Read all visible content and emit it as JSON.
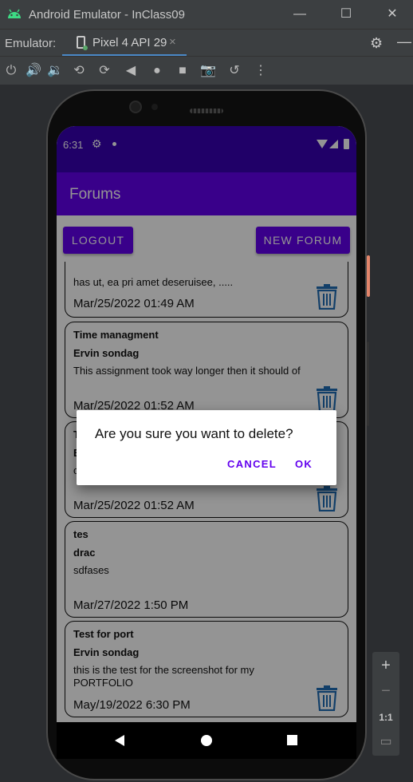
{
  "window": {
    "title": "Android Emulator - InClass09",
    "controls": [
      "—",
      "☐",
      "✕"
    ]
  },
  "tabbar": {
    "label": "Emulator:",
    "tab_label": "Pixel 4 API 29",
    "tab_close": "×",
    "settings_glyph": "⚙",
    "minimize_glyph": "—"
  },
  "toolbar": {
    "tools": [
      {
        "name": "power-icon",
        "glyph": "⏻"
      },
      {
        "name": "volume-up-icon",
        "glyph": "🔊"
      },
      {
        "name": "volume-down-icon",
        "glyph": "🔉"
      },
      {
        "name": "rotate-left-icon",
        "glyph": "⟲"
      },
      {
        "name": "rotate-right-icon",
        "glyph": "⟳"
      },
      {
        "name": "back-icon",
        "glyph": "◀"
      },
      {
        "name": "home-icon",
        "glyph": "●"
      },
      {
        "name": "overview-icon",
        "glyph": "■"
      },
      {
        "name": "camera-icon",
        "glyph": "📷"
      },
      {
        "name": "snapshot-icon",
        "glyph": "↺"
      },
      {
        "name": "more-icon",
        "glyph": "⋮"
      }
    ]
  },
  "zoom": {
    "plus": "+",
    "minus": "−",
    "ratio": "1:1",
    "fit": "▭"
  },
  "device": {
    "status": {
      "time": "6:31",
      "gear": "⚙"
    },
    "app_title": "Forums",
    "buttons": {
      "logout": "LOGOUT",
      "new_forum": "NEW FORUM"
    },
    "forums": [
      {
        "title": "",
        "author": "",
        "body": "has ut, ea pri amet deseruisee, .....",
        "date": "Mar/25/2022 01:49 AM"
      },
      {
        "title": "Time managment",
        "author": "Ervin sondag",
        "body": "This assignment took way longer then it should of",
        "date": "Mar/25/2022 01:52 AM"
      },
      {
        "title": "T",
        "author": "E",
        "body": "c",
        "date": "Mar/25/2022 01:52 AM"
      },
      {
        "title": "tes",
        "author": "drac",
        "body": "sdfases",
        "date": "Mar/27/2022 1:50 PM"
      },
      {
        "title": "Test for port",
        "author": "Ervin sondag",
        "body": "this is the test for the screenshot for my PORTFOLIO",
        "date": "May/19/2022 6:30 PM"
      }
    ],
    "dialog": {
      "message": "Are you sure you want to delete?",
      "cancel": "CANCEL",
      "ok": "OK"
    }
  },
  "colors": {
    "primary": "#6200ee",
    "primary_dark": "#3700b3",
    "trash": "#1f6db5",
    "accent_side": "#e5866b"
  }
}
